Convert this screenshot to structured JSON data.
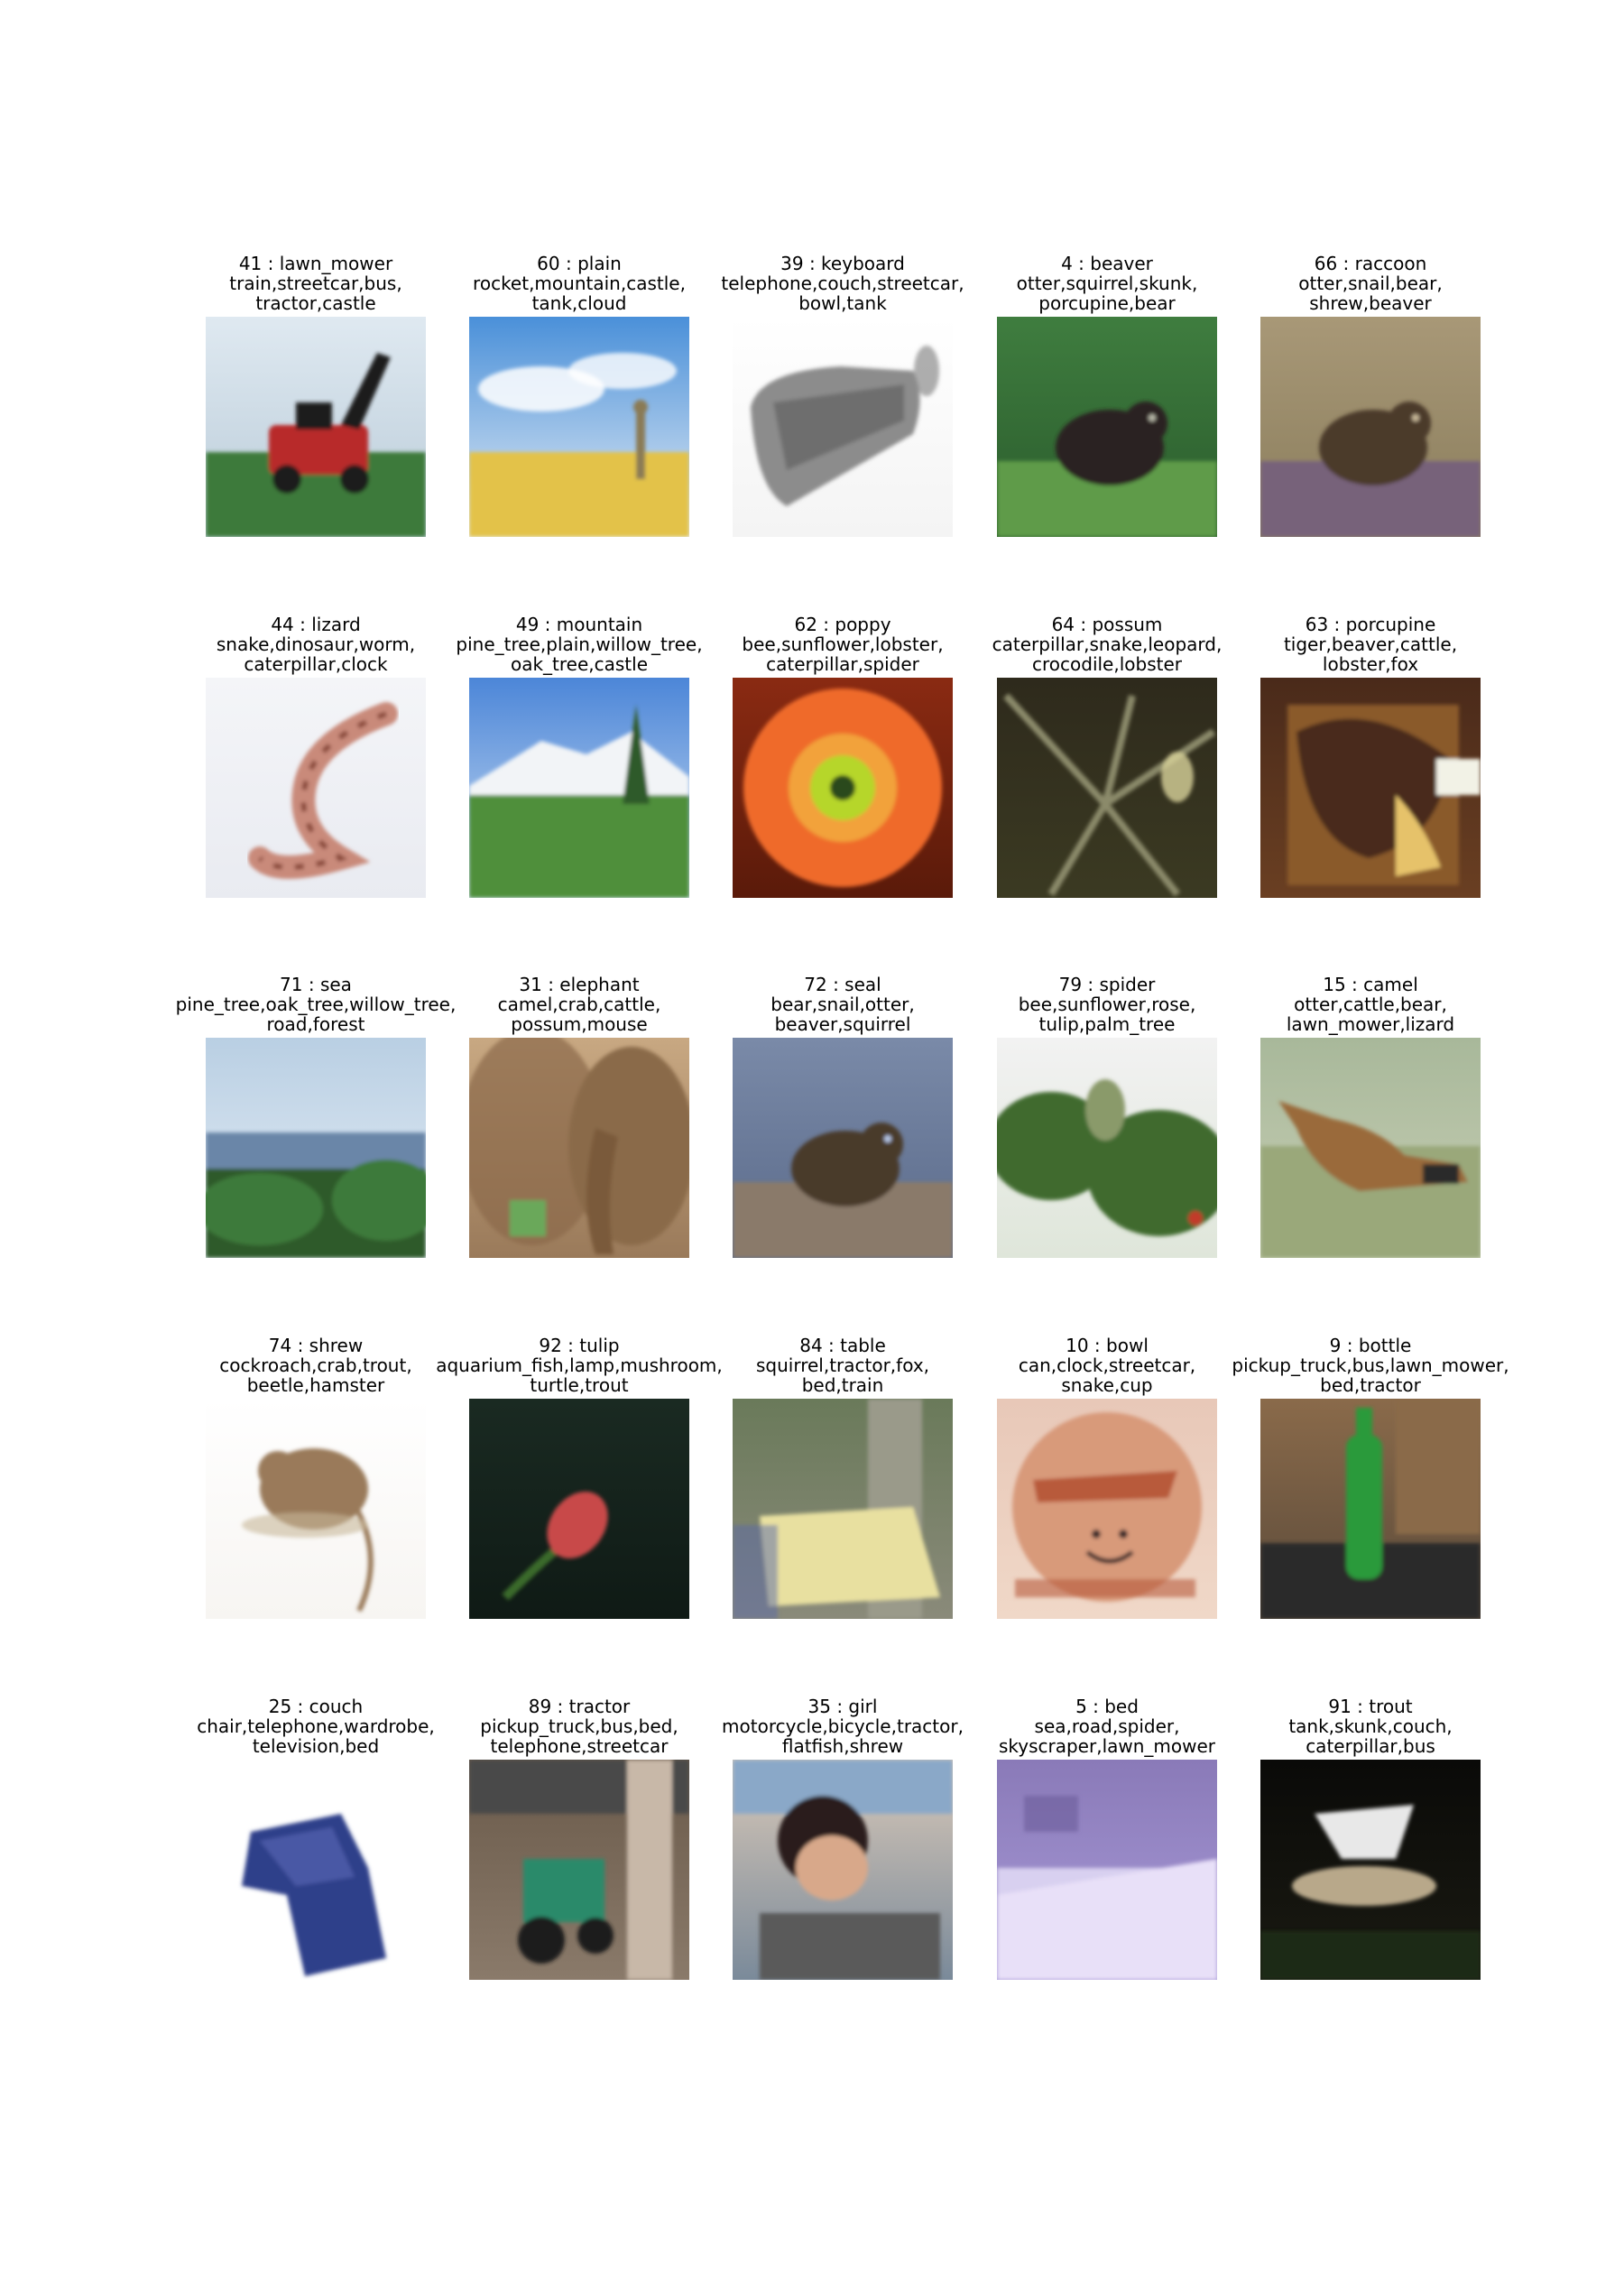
{
  "samples": [
    {
      "label_line": "41 : lawn_mower",
      "top5_line1": "train,streetcar,bus,",
      "top5_line2": "tractor,castle",
      "scene": {
        "bg": [
          "#dfe9f1",
          "#b9cbd8"
        ],
        "ground": "#3e7a3a",
        "subject": "#b8292a",
        "accent": "#1f1f1f",
        "shape": "mower"
      }
    },
    {
      "label_line": "60 : plain",
      "top5_line1": "rocket,mountain,castle,",
      "top5_line2": "tank,cloud",
      "scene": {
        "bg": [
          "#4a90d9",
          "#e7eef5"
        ],
        "ground": "#e3c24a",
        "subject": "#8a7a55",
        "accent": "#ffffff",
        "shape": "plain"
      }
    },
    {
      "label_line": "39 : keyboard",
      "top5_line1": "telephone,couch,streetcar,",
      "top5_line2": "bowl,tank",
      "scene": {
        "bg": [
          "#ffffff",
          "#f4f4f4"
        ],
        "ground": "#ffffff",
        "subject": "#8c8c8c",
        "accent": "#5a5a5a",
        "shape": "keyboard"
      }
    },
    {
      "label_line": "4 : beaver",
      "top5_line1": "otter,squirrel,skunk,",
      "top5_line2": "porcupine,bear",
      "scene": {
        "bg": [
          "#3f7d3f",
          "#2a5b2c"
        ],
        "ground": "#5f9b4a",
        "subject": "#2a2320",
        "accent": "#b8b8a8",
        "shape": "animal"
      }
    },
    {
      "label_line": "66 : raccoon",
      "top5_line1": "otter,snail,bear,",
      "top5_line2": "shrew,beaver",
      "scene": {
        "bg": [
          "#a89877",
          "#8a7d5c"
        ],
        "ground": "#77627a",
        "subject": "#4b3a2b",
        "accent": "#c9b99a",
        "shape": "animal"
      }
    },
    {
      "label_line": "44 : lizard",
      "top5_line1": "snake,dinosaur,worm,",
      "top5_line2": "caterpillar,clock",
      "scene": {
        "bg": [
          "#f4f5f8",
          "#e9ebf1"
        ],
        "ground": "#f2f2f5",
        "subject": "#c98a7a",
        "accent": "#8a4a3a",
        "shape": "lizard"
      }
    },
    {
      "label_line": "49 : mountain",
      "top5_line1": "pine_tree,plain,willow_tree,",
      "top5_line2": "oak_tree,castle",
      "scene": {
        "bg": [
          "#4c86d8",
          "#cfe0f2"
        ],
        "ground": "#4f8f3a",
        "subject": "#f2f4f7",
        "accent": "#2f5a2a",
        "shape": "mountain"
      }
    },
    {
      "label_line": "62 : poppy",
      "top5_line1": "bee,sunflower,lobster,",
      "top5_line2": "caterpillar,spider",
      "scene": {
        "bg": [
          "#8a2a12",
          "#5a1a0a"
        ],
        "ground": "#9a2f14",
        "subject": "#ef6a2a",
        "accent": "#b6d62a",
        "shape": "flower"
      }
    },
    {
      "label_line": "64 : possum",
      "top5_line1": "caterpillar,snake,leopard,",
      "top5_line2": "crocodile,lobster",
      "scene": {
        "bg": [
          "#2e2a1c",
          "#3b3a22"
        ],
        "ground": "#2a2a1a",
        "subject": "#8b8a6a",
        "accent": "#d8d29a",
        "shape": "branches"
      }
    },
    {
      "label_line": "63 : porcupine",
      "top5_line1": "tiger,beaver,cattle,",
      "top5_line2": "lobster,fox",
      "scene": {
        "bg": [
          "#4a2a1a",
          "#6a3f22"
        ],
        "ground": "#2a1a12",
        "subject": "#8a5a2a",
        "accent": "#e6c26a",
        "shape": "porcupine"
      }
    },
    {
      "label_line": "71 : sea",
      "top5_line1": "pine_tree,oak_tree,willow_tree,",
      "top5_line2": "road,forest",
      "scene": {
        "bg": [
          "#b9cfe3",
          "#e6eef6"
        ],
        "ground": "#2d5a2a",
        "subject": "#6a86a8",
        "accent": "#3e7a3a",
        "shape": "sea"
      }
    },
    {
      "label_line": "31 : elephant",
      "top5_line1": "camel,crab,cattle,",
      "top5_line2": "possum,mouse",
      "scene": {
        "bg": [
          "#c8a882",
          "#9a7a5a"
        ],
        "ground": "#a88a6a",
        "subject": "#8a6a4a",
        "accent": "#6aa85a",
        "shape": "elephant"
      }
    },
    {
      "label_line": "72 : seal",
      "top5_line1": "bear,snail,otter,",
      "top5_line2": "beaver,squirrel",
      "scene": {
        "bg": [
          "#7a8aa8",
          "#5a6a8a"
        ],
        "ground": "#8a7a6a",
        "subject": "#4a3a2a",
        "accent": "#b8c8e8",
        "shape": "animal"
      }
    },
    {
      "label_line": "79 : spider",
      "top5_line1": "bee,sunflower,rose,",
      "top5_line2": "tulip,palm_tree",
      "scene": {
        "bg": [
          "#f2f2f2",
          "#dfe6da"
        ],
        "ground": "#3f6a2f",
        "subject": "#8a9a6a",
        "accent": "#c23a2a",
        "shape": "foliage"
      }
    },
    {
      "label_line": "15 : camel",
      "top5_line1": "otter,cattle,bear,",
      "top5_line2": "lawn_mower,lizard",
      "scene": {
        "bg": [
          "#a8b89a",
          "#c8cfb5"
        ],
        "ground": "#9aa87a",
        "subject": "#9a6a3a",
        "accent": "#2a2a2a",
        "shape": "camel"
      }
    },
    {
      "label_line": "74 : shrew",
      "top5_line1": "cockroach,crab,trout,",
      "top5_line2": "beetle,hamster",
      "scene": {
        "bg": [
          "#ffffff",
          "#f7f5f2"
        ],
        "ground": "#ffffff",
        "subject": "#9a7a5a",
        "accent": "#c8b89a",
        "shape": "shrew"
      }
    },
    {
      "label_line": "92 : tulip",
      "top5_line1": "aquarium_fish,lamp,mushroom,",
      "top5_line2": "turtle,trout",
      "scene": {
        "bg": [
          "#1a2a22",
          "#0f1a15"
        ],
        "ground": "#122018",
        "subject": "#c84a4a",
        "accent": "#3a6a2a",
        "shape": "tulip"
      }
    },
    {
      "label_line": "84 : table",
      "top5_line1": "squirrel,tractor,fox,",
      "top5_line2": "bed,train",
      "scene": {
        "bg": [
          "#6a7a5a",
          "#8a8a7a"
        ],
        "ground": "#4a4a4a",
        "subject": "#e8e0a0",
        "accent": "#5a6aa8",
        "shape": "table"
      }
    },
    {
      "label_line": "10 : bowl",
      "top5_line1": "can,clock,streetcar,",
      "top5_line2": "snake,cup",
      "scene": {
        "bg": [
          "#e8c8b8",
          "#f0d8c8"
        ],
        "ground": "#d89a7a",
        "subject": "#b85a3a",
        "accent": "#3a2a2a",
        "shape": "bowl"
      }
    },
    {
      "label_line": "9 : bottle",
      "top5_line1": "pickup_truck,bus,lawn_mower,",
      "top5_line2": "bed,tractor",
      "scene": {
        "bg": [
          "#8a6a4a",
          "#5a4a3a"
        ],
        "ground": "#2a2a2a",
        "subject": "#2a9a3a",
        "accent": "#d8d8d8",
        "shape": "bottle"
      }
    },
    {
      "label_line": "25 : couch",
      "top5_line1": "chair,telephone,wardrobe,",
      "top5_line2": "television,bed",
      "scene": {
        "bg": [
          "#ffffff",
          "#ffffff"
        ],
        "ground": "#ffffff",
        "subject": "#2f3f8a",
        "accent": "#5a6ab8",
        "shape": "chair"
      }
    },
    {
      "label_line": "89 : tractor",
      "top5_line1": "pickup_truck,bus,bed,",
      "top5_line2": "telephone,streetcar",
      "scene": {
        "bg": [
          "#6a5a4a",
          "#8a7a6a"
        ],
        "ground": "#5a5a5a",
        "subject": "#2a8a6a",
        "accent": "#c8b8a8",
        "shape": "tractor"
      }
    },
    {
      "label_line": "35 : girl",
      "top5_line1": "motorcycle,bicycle,tractor,",
      "top5_line2": "flatfish,shrew",
      "scene": {
        "bg": [
          "#d8c8b8",
          "#7a8a9a"
        ],
        "ground": "#5a5a5a",
        "subject": "#2a1f1a",
        "accent": "#d8a88a",
        "shape": "person"
      }
    },
    {
      "label_line": "5 : bed",
      "top5_line1": "sea,road,spider,",
      "top5_line2": "skyscraper,lawn_mower",
      "scene": {
        "bg": [
          "#8a7ab8",
          "#a89ad8"
        ],
        "ground": "#d8d0f0",
        "subject": "#e8e0f8",
        "accent": "#6a5a9a",
        "shape": "bed"
      }
    },
    {
      "label_line": "91 : trout",
      "top5_line1": "tank,skunk,couch,",
      "top5_line2": "caterpillar,bus",
      "scene": {
        "bg": [
          "#0a0a08",
          "#1a1a12"
        ],
        "ground": "#1a2a12",
        "subject": "#b8a88a",
        "accent": "#e8e8e8",
        "shape": "trout"
      }
    }
  ]
}
